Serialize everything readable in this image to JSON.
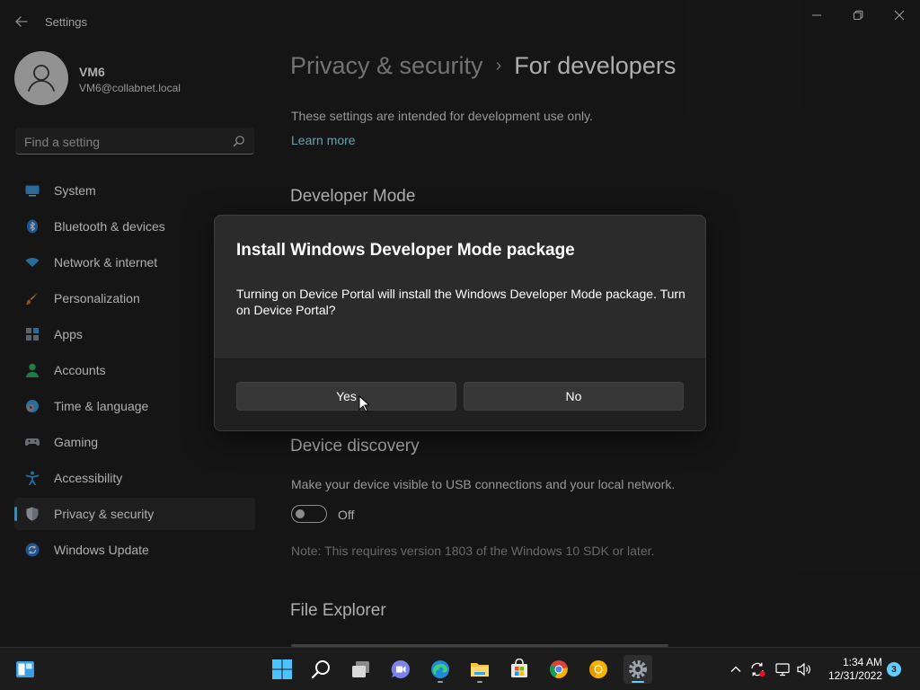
{
  "window": {
    "title": "Settings",
    "controls": [
      "minimize-icon",
      "maximize-icon",
      "close-icon"
    ]
  },
  "user": {
    "name": "VM6",
    "email": "VM6@collabnet.local"
  },
  "search": {
    "placeholder": "Find a setting",
    "icon": "search-icon"
  },
  "sidebar": {
    "items": [
      {
        "label": "System",
        "icon": "system-icon",
        "active": false
      },
      {
        "label": "Bluetooth & devices",
        "icon": "bluetooth-icon",
        "active": false
      },
      {
        "label": "Network & internet",
        "icon": "wifi-icon",
        "active": false
      },
      {
        "label": "Personalization",
        "icon": "brush-icon",
        "active": false
      },
      {
        "label": "Apps",
        "icon": "apps-icon",
        "active": false
      },
      {
        "label": "Accounts",
        "icon": "accounts-icon",
        "active": false
      },
      {
        "label": "Time & language",
        "icon": "globe-clock-icon",
        "active": false
      },
      {
        "label": "Gaming",
        "icon": "gamepad-icon",
        "active": false
      },
      {
        "label": "Accessibility",
        "icon": "accessibility-icon",
        "active": false
      },
      {
        "label": "Privacy & security",
        "icon": "shield-icon",
        "active": true
      },
      {
        "label": "Windows Update",
        "icon": "update-icon",
        "active": false
      }
    ]
  },
  "breadcrumb": {
    "parent": "Privacy & security",
    "separator": "›",
    "current": "For developers"
  },
  "content": {
    "intro": "These settings are intended for development use only.",
    "learn_more": "Learn more",
    "developer_mode_title": "Developer Mode",
    "device_discovery_title": "Device discovery",
    "device_discovery_desc": "Make your device visible to USB connections and your local network.",
    "device_discovery_toggle": "Off",
    "device_discovery_note": "Note: This requires version 1803 of the Windows 10 SDK or later.",
    "file_explorer_title": "File Explorer"
  },
  "dialog": {
    "title": "Install Windows Developer Mode package",
    "body": "Turning on Device Portal will install the Windows Developer Mode package. Turn on Device Portal?",
    "yes": "Yes",
    "no": "No"
  },
  "taskbar": {
    "apps": [
      "start-icon",
      "search-icon",
      "task-view-icon",
      "teams-chat-icon",
      "edge-icon",
      "file-explorer-icon",
      "store-icon",
      "chrome-icon",
      "chrome-canary-icon",
      "settings-icon"
    ],
    "active_app": "settings-icon",
    "tray": [
      "chevron-up-icon",
      "sync-icon",
      "network-icon",
      "volume-icon"
    ],
    "time": "1:34 AM",
    "date": "12/31/2022",
    "notification_count": "3"
  },
  "colors": {
    "accent": "#60cdff",
    "background": "#202020",
    "dialog": "#2b2b2b",
    "link": "#99ebff"
  }
}
